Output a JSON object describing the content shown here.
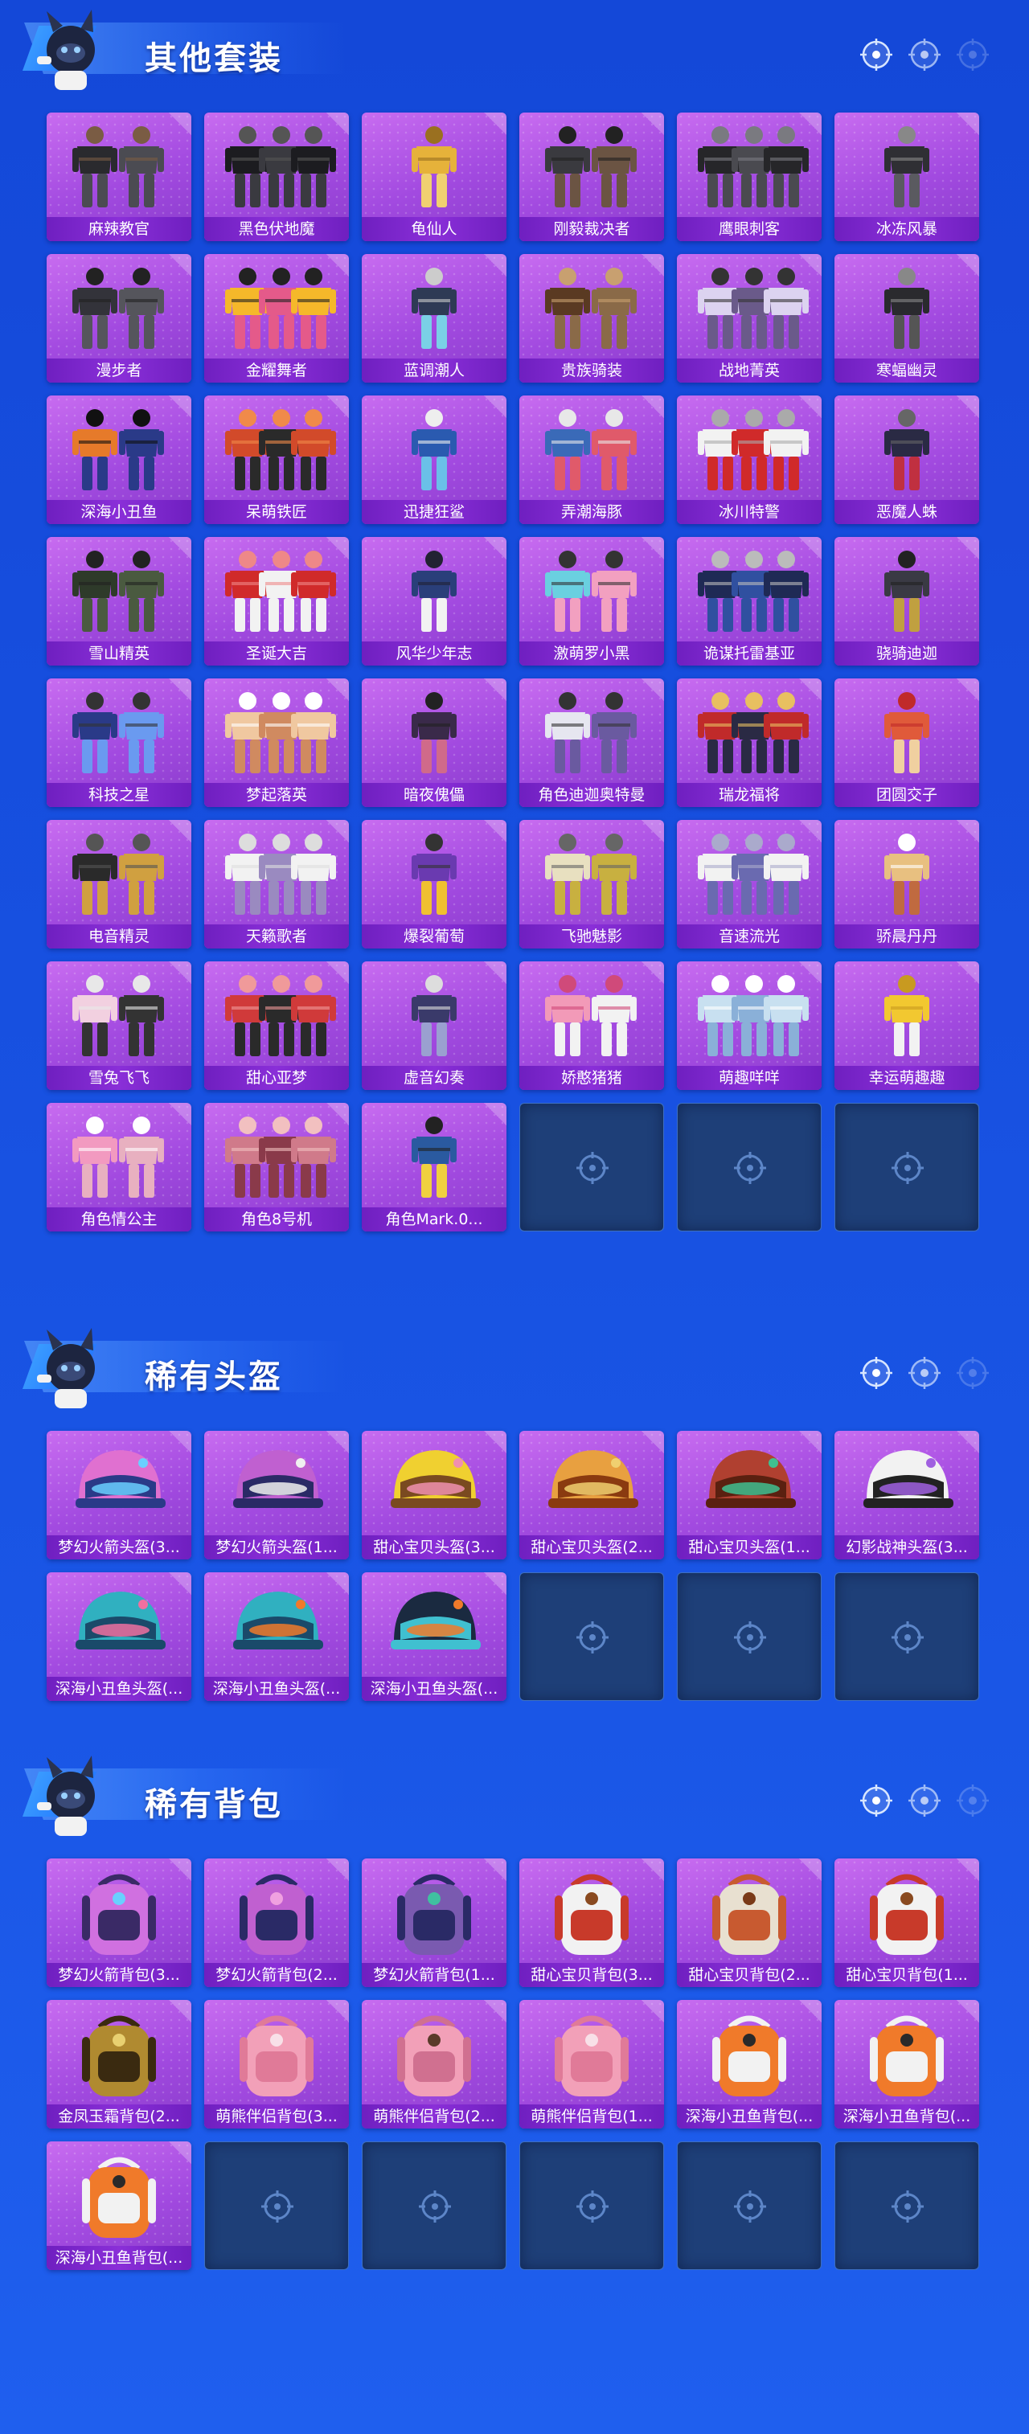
{
  "sections": [
    {
      "title": "其他套装",
      "items": [
        "麻辣教官",
        "黑色伏地魔",
        "龟仙人",
        "刚毅裁决者",
        "鹰眼刺客",
        "冰冻风暴",
        "漫步者",
        "金耀舞者",
        "蓝调潮人",
        "贵族骑装",
        "战地菁英",
        "寒蝠幽灵",
        "深海小丑鱼",
        "呆萌铁匠",
        "迅捷狂鲨",
        "弄潮海豚",
        "冰川特警",
        "恶魔人蛛",
        "雪山精英",
        "圣诞大吉",
        "风华少年志",
        "激萌罗小黑",
        "诡谋托雷基亚",
        "骁骑迪迦",
        "科技之星",
        "梦起落英",
        "暗夜傀儡",
        "角色迪迦奥特曼",
        "瑞龙福将",
        "团圆交子",
        "电音精灵",
        "天籁歌者",
        "爆裂葡萄",
        "飞驰魅影",
        "音速流光",
        "骄晨丹丹",
        "雪兔飞飞",
        "甜心亚梦",
        "虚音幻奏",
        "娇憨猪猪",
        "萌趣咩咩",
        "幸运萌趣趣",
        "角色情公主",
        "角色8号机",
        "角色Mark.0..."
      ],
      "empty_slots": 3
    },
    {
      "title": "稀有头盔",
      "items": [
        "梦幻火箭头盔(3...",
        "梦幻火箭头盔(1...",
        "甜心宝贝头盔(3...",
        "甜心宝贝头盔(2...",
        "甜心宝贝头盔(1...",
        "幻影战神头盔(3...",
        "深海小丑鱼头盔(...",
        "深海小丑鱼头盔(...",
        "深海小丑鱼头盔(..."
      ],
      "empty_slots": 3
    },
    {
      "title": "稀有背包",
      "items": [
        "梦幻火箭背包(3...",
        "梦幻火箭背包(2...",
        "梦幻火箭背包(1...",
        "甜心宝贝背包(3...",
        "甜心宝贝背包(2...",
        "甜心宝贝背包(1...",
        "金凤玉霜背包(2...",
        "萌熊伴侣背包(3...",
        "萌熊伴侣背包(2...",
        "萌熊伴侣背包(1...",
        "深海小丑鱼背包(...",
        "深海小丑鱼背包(...",
        "深海小丑鱼背包(..."
      ],
      "empty_slots": 5
    }
  ],
  "icons": {
    "empty_slot": "crosshair-icon",
    "header_dots": "target-icon",
    "mascot": "mascot-icon"
  },
  "colors": {
    "background": "#1750e0",
    "card": "#a24ae0",
    "label_bar": "#7a25cc",
    "empty_slot": "#1e3f78"
  }
}
